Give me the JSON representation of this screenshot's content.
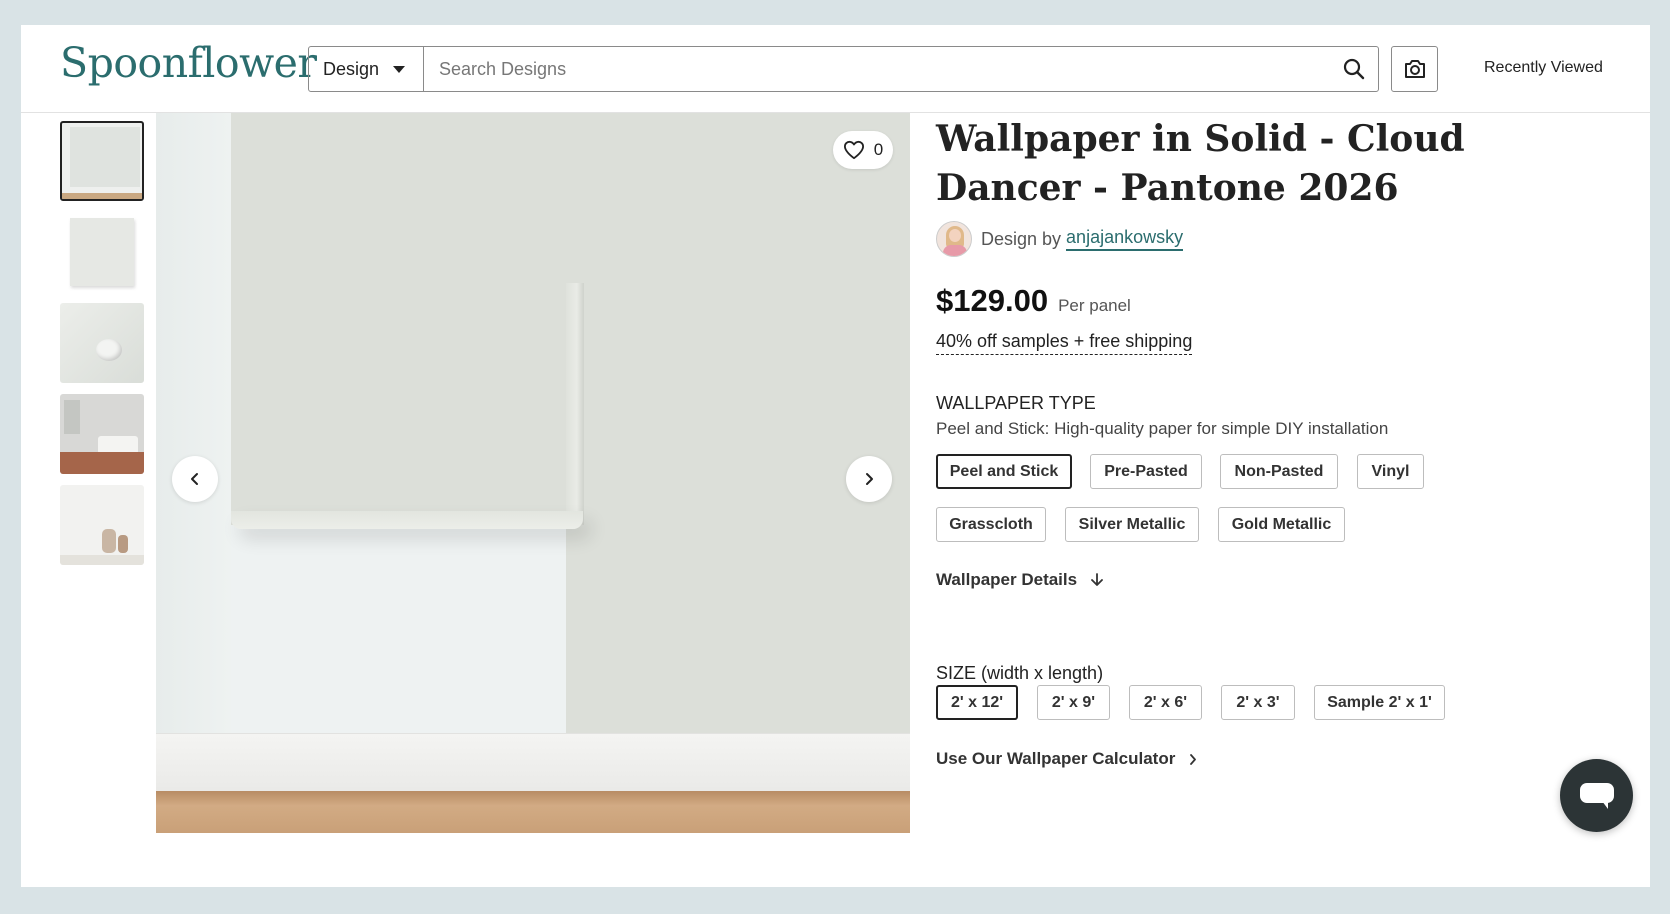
{
  "header": {
    "logo": "Spoonflower",
    "search_type": "Design",
    "search_placeholder": "Search Designs",
    "recently_viewed": "Recently Viewed"
  },
  "gallery": {
    "favorites_count": "0",
    "thumbnail_count": 5,
    "active_thumbnail": 1
  },
  "product": {
    "title": "Wallpaper in Solid - Cloud Dancer - Pantone 2026",
    "design_by_label": "Design by",
    "designer": "anjajankowsky",
    "price": "$129.00",
    "price_unit": "Per panel",
    "promo": "40% off samples + free shipping"
  },
  "wallpaper_type": {
    "label": "WALLPAPER TYPE",
    "description": "Peel and Stick: High-quality paper for simple DIY installation",
    "options": [
      "Peel and Stick",
      "Pre-Pasted",
      "Non-Pasted",
      "Vinyl",
      "Grasscloth",
      "Silver Metallic",
      "Gold Metallic"
    ],
    "selected": "Peel and Stick"
  },
  "details_label": "Wallpaper Details",
  "size": {
    "label": "SIZE (width x length)",
    "options": [
      "2' x 12'",
      "2' x 9'",
      "2' x 6'",
      "2' x 3'",
      "Sample 2' x 1'"
    ],
    "selected": "2' x 12'"
  },
  "calculator_label": "Use Our Wallpaper Calculator",
  "colors": {
    "brand": "#2b6d6e",
    "page_background": "#d9e3e6",
    "chat_button": "#2c3436"
  },
  "icons": [
    "search-icon",
    "camera-icon",
    "heart-icon",
    "chevron-left-icon",
    "chevron-right-icon",
    "arrow-down-icon",
    "chat-icon"
  ]
}
